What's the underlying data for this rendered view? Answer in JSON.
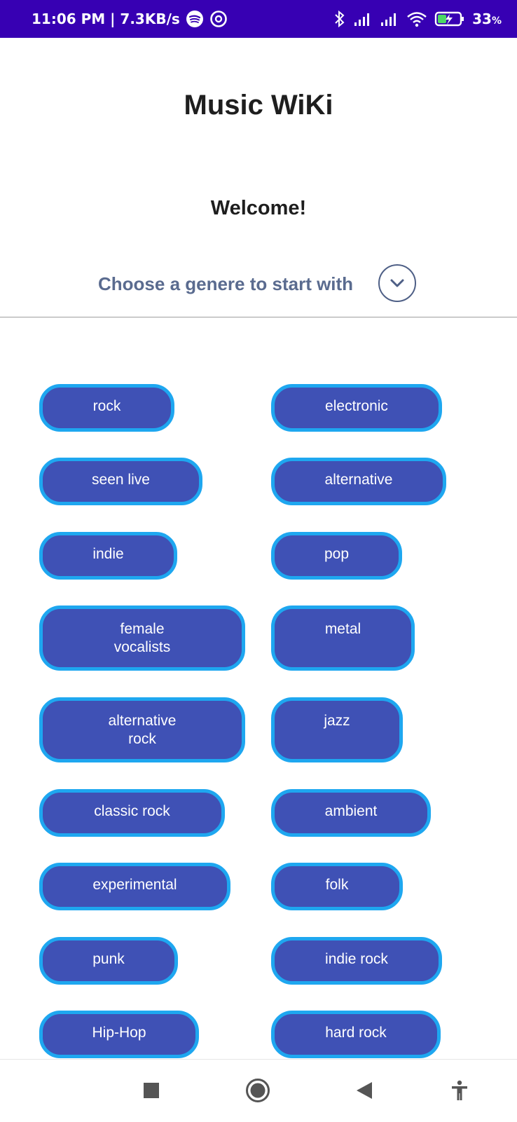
{
  "status_bar": {
    "time_speed": "11:06 PM | 7.3KB/s",
    "battery": "33",
    "battery_unit": "%",
    "icons": [
      "spotify-icon",
      "at-sign-icon",
      "bluetooth-icon",
      "signal-icon",
      "signal-icon",
      "wifi-icon",
      "battery-charging-icon"
    ]
  },
  "header": {
    "title": "Music WiKi",
    "welcome": "Welcome!",
    "chooser_label": "Choose a genere to start with",
    "chooser_icon": "chevron-down-icon",
    "accent": "#5a6b8f"
  },
  "genres": [
    {
      "label": "rock"
    },
    {
      "label": "electronic"
    },
    {
      "label": "seen live"
    },
    {
      "label": "alternative"
    },
    {
      "label": "indie"
    },
    {
      "label": "pop"
    },
    {
      "label": "female\nvocalists"
    },
    {
      "label": "metal"
    },
    {
      "label": "alternative\nrock"
    },
    {
      "label": "jazz"
    },
    {
      "label": "classic rock"
    },
    {
      "label": "ambient"
    },
    {
      "label": "experimental"
    },
    {
      "label": "folk"
    },
    {
      "label": "punk"
    },
    {
      "label": "indie rock"
    },
    {
      "label": "Hip-Hop"
    },
    {
      "label": "hard rock"
    }
  ],
  "colors": {
    "status_bar": "#3700B3",
    "chip_fill": "#3F51B5",
    "chip_border": "#1ea7f0"
  },
  "nav_bar": {
    "icons": [
      "recent-apps-icon",
      "home-icon",
      "back-icon",
      "accessibility-icon"
    ]
  }
}
